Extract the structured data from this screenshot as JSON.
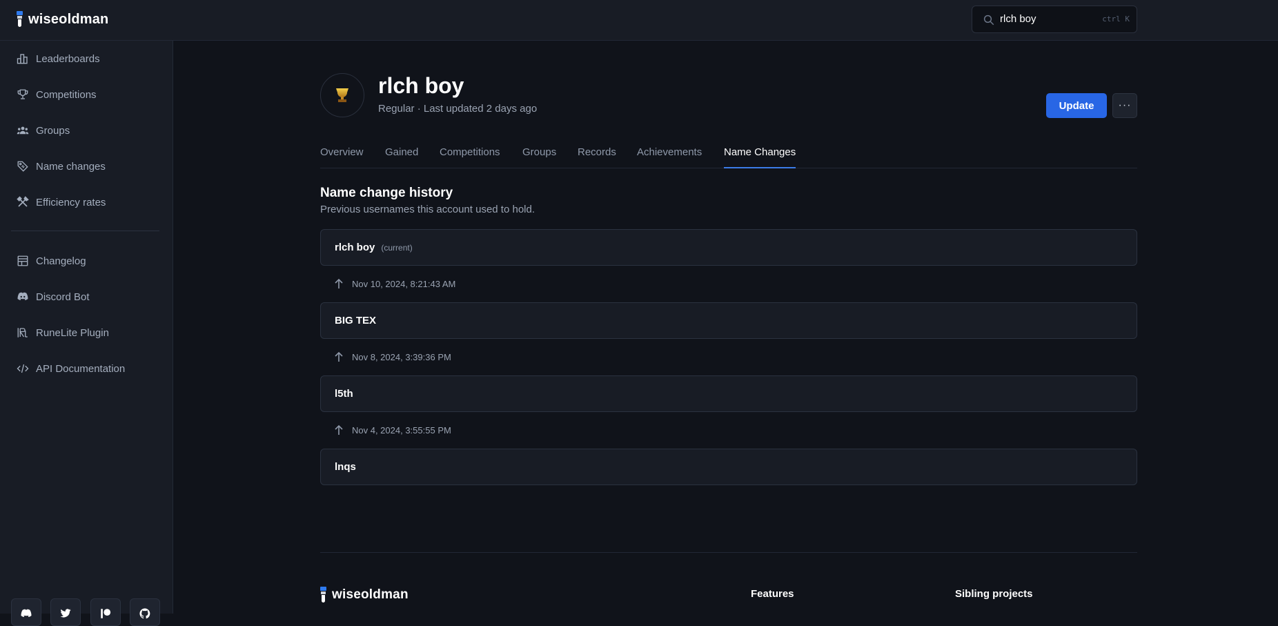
{
  "app": {
    "name": "wiseoldman"
  },
  "search": {
    "value": "rlch boy",
    "shortcut": "ctrl K"
  },
  "sidebar": {
    "primary": [
      {
        "label": "Leaderboards",
        "icon": "bar-chart-icon"
      },
      {
        "label": "Competitions",
        "icon": "trophy-icon"
      },
      {
        "label": "Groups",
        "icon": "users-icon"
      },
      {
        "label": "Name changes",
        "icon": "tag-icon"
      },
      {
        "label": "Efficiency rates",
        "icon": "tools-icon"
      }
    ],
    "secondary": [
      {
        "label": "Changelog",
        "icon": "changelog-icon"
      },
      {
        "label": "Discord Bot",
        "icon": "discord-icon"
      },
      {
        "label": "RuneLite Plugin",
        "icon": "runelite-icon"
      },
      {
        "label": "API Documentation",
        "icon": "code-icon"
      }
    ],
    "social": [
      "discord-icon",
      "twitter-icon",
      "patreon-icon",
      "github-icon"
    ]
  },
  "player": {
    "name": "rlch boy",
    "type": "Regular",
    "last_updated": "Regular · Last updated 2 days ago",
    "avatar_icon": "trophy-icon"
  },
  "actions": {
    "update_label": "Update",
    "more_label": "···"
  },
  "tabs": [
    {
      "label": "Overview",
      "active": false
    },
    {
      "label": "Gained",
      "active": false
    },
    {
      "label": "Competitions",
      "active": false
    },
    {
      "label": "Groups",
      "active": false
    },
    {
      "label": "Records",
      "active": false
    },
    {
      "label": "Achievements",
      "active": false
    },
    {
      "label": "Name Changes",
      "active": true
    }
  ],
  "section": {
    "title": "Name change history",
    "subtitle": "Previous usernames this account used to hold."
  },
  "names": [
    {
      "name": "rlch boy",
      "tag": "(current)"
    },
    {
      "name": "BIG TEX",
      "tag": ""
    },
    {
      "name": "l5th",
      "tag": ""
    },
    {
      "name": "lnqs",
      "tag": ""
    }
  ],
  "changes": [
    {
      "date": "Nov 10, 2024, 8:21:43 AM"
    },
    {
      "date": "Nov 8, 2024, 3:39:36 PM"
    },
    {
      "date": "Nov 4, 2024, 3:55:55 PM"
    }
  ],
  "footer": {
    "logo": "wiseoldman",
    "columns": [
      "Features",
      "Sibling projects"
    ]
  },
  "colors": {
    "accent": "#2866e5",
    "tab_underline": "#3b7ce8",
    "background": "#10131a",
    "surface": "#181c25",
    "border": "#2b3240"
  }
}
